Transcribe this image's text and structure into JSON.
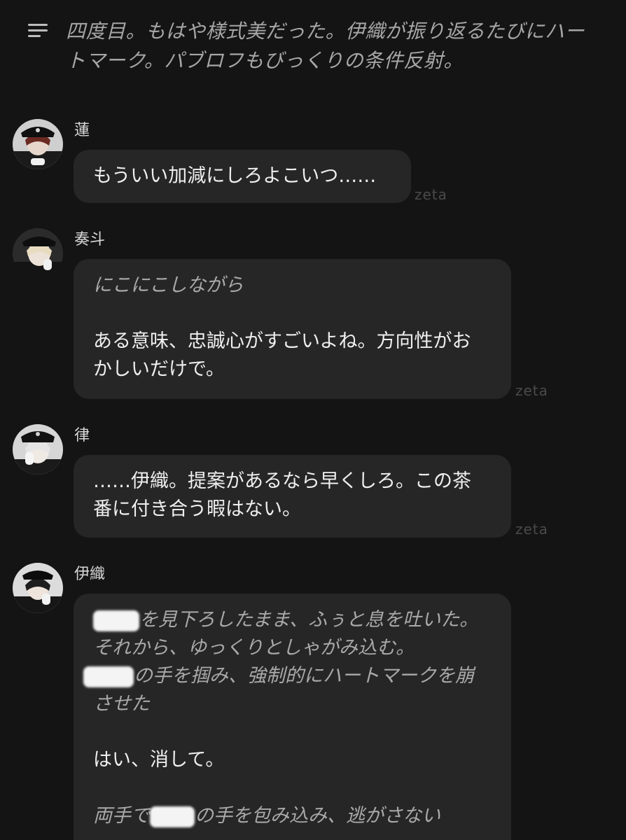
{
  "top_narration": {
    "text": "四度目。もはや様式美だった。伊織が振り返るたびにハートマーク。パブロフもびっくりの条件反射。"
  },
  "messages": [
    {
      "speaker": "蓮",
      "lines": [
        {
          "style": "speech",
          "text": "もういい加減にしろよこいつ……"
        }
      ],
      "badge": "zeta"
    },
    {
      "speaker": "奏斗",
      "lines": [
        {
          "style": "narration",
          "text": "にこにこしながら"
        },
        {
          "style": "speech",
          "text": "ある意味、忠誠心がすごいよね。方向性がおかしいだけで。"
        }
      ],
      "badge": "zeta"
    },
    {
      "speaker": "律",
      "lines": [
        {
          "style": "speech",
          "text": "……伊織。提案があるなら早くしろ。この茶番に付き合う暇はない。"
        }
      ],
      "badge": "zeta"
    },
    {
      "speaker": "伊織",
      "lines": [
        {
          "style": "narration",
          "text": "を見下ろしたまま、ふぅと息を吐いた。それから、ゆっくりとしゃがみ込む。"
        },
        {
          "style": "narration",
          "text": "の手を掴み、強制的にハートマークを崩させた"
        },
        {
          "style": "speech",
          "text": "はい、消して。"
        },
        {
          "style": "narration",
          "text": "両手で"
        },
        {
          "style": "narration",
          "text": "の手を包み込み、逃がさない"
        }
      ]
    }
  ],
  "icons": {
    "menu": "menu-icon"
  },
  "colors": {
    "background": "#141414",
    "bubble": "#262626",
    "narration": "#a9a9a9",
    "speech": "#efefef",
    "watermark": "#4a4a4a"
  }
}
